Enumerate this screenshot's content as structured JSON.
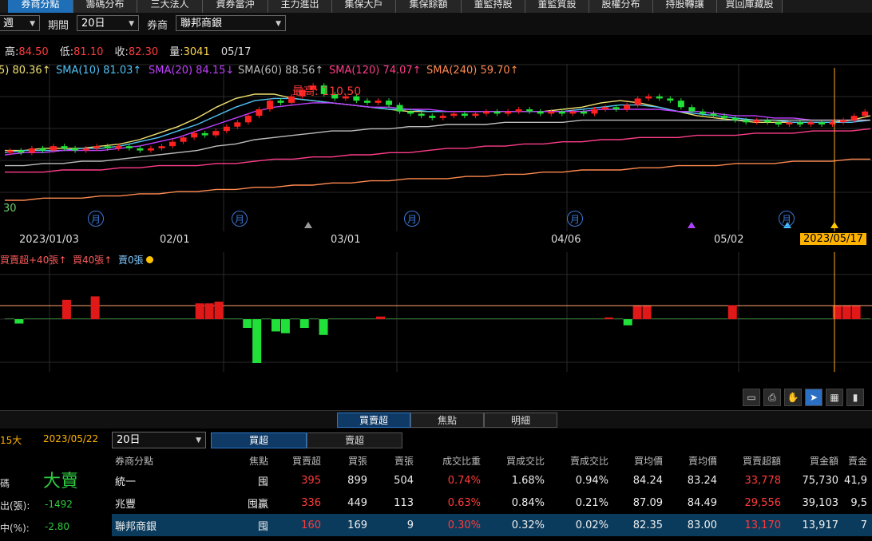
{
  "top_tabs": [
    {
      "label": "券商分點",
      "active": true
    },
    {
      "label": "籌碼分布"
    },
    {
      "label": "三大法人"
    },
    {
      "label": "資券當沖"
    },
    {
      "label": "主力進出"
    },
    {
      "label": "集保大戶"
    },
    {
      "label": "集保餘額"
    },
    {
      "label": "董監持股"
    },
    {
      "label": "董監質設"
    },
    {
      "label": "股權分布"
    },
    {
      "label": "持股轉讓"
    },
    {
      "label": "買回庫藏股"
    }
  ],
  "filter": {
    "first_select": "週",
    "period_label": "期間",
    "period_value": "20日",
    "broker_label": "券商",
    "broker_value": "聯邦商銀"
  },
  "quote": {
    "high_label": "高:",
    "high": "84.50",
    "low_label": "低:",
    "low": "81.10",
    "close_label": "收:",
    "close": "82.30",
    "vol_label": "量:",
    "volume": "3041",
    "date": "05/17"
  },
  "sma_legend": [
    {
      "text": "5) 80.36↑",
      "color": "#f0e070"
    },
    {
      "text": "SMA(10) 81.03↑",
      "color": "#4fc3f7"
    },
    {
      "text": "SMA(20) 84.15↓",
      "color": "#c040ff"
    },
    {
      "text": "SMA(60) 88.56↑",
      "color": "#bdbdbd"
    },
    {
      "text": "SMA(120) 74.07↑",
      "color": "#ff3d8a"
    },
    {
      "text": "SMA(240) 59.70↑",
      "color": "#ff8a50"
    }
  ],
  "max_label": "最高: 110.50",
  "left_price": "30",
  "x_labels": [
    "2023/01/03",
    "02/01",
    "03/01",
    "04/06",
    "05/02"
  ],
  "cursor_date": "2023/05/17",
  "month_marker": "月",
  "vol_legend": {
    "t1": "買賣超+40張↑",
    "t2": "買40張↑",
    "t3": "賣0張"
  },
  "tool_icons": [
    "page-icon",
    "print-icon",
    "hand-icon",
    "pointer-icon",
    "table-icon",
    "bar-chart-icon"
  ],
  "sub_tabs": [
    {
      "label": "買賣超",
      "active": true
    },
    {
      "label": "焦點"
    },
    {
      "label": "明細"
    }
  ],
  "left_panel": {
    "period": "15大",
    "date": "2023/05/22",
    "signal_label": "碼",
    "signal": "大賣",
    "net_label": "出(張):",
    "net": "-1492",
    "pct_label": "中(%):",
    "pct": "-2.80"
  },
  "range_select": "20日",
  "buysell_tabs": [
    "買超",
    "賣超"
  ],
  "table": {
    "headers": [
      "券商分點",
      "焦點",
      "買賣超",
      "買張",
      "賣張",
      "成交比重",
      "買成交比",
      "賣成交比",
      "買均價",
      "賣均價",
      "買賣超額",
      "買金額",
      "賣金"
    ],
    "rows": [
      [
        "統一",
        "囤",
        "395",
        "899",
        "504",
        "0.74%",
        "1.68%",
        "0.94%",
        "84.24",
        "83.24",
        "33,778",
        "75,730",
        "41,9"
      ],
      [
        "兆豐",
        "囤贏",
        "336",
        "449",
        "113",
        "0.63%",
        "0.84%",
        "0.21%",
        "87.09",
        "84.49",
        "29,556",
        "39,103",
        "9,5"
      ],
      [
        "聯邦商銀",
        "囤",
        "160",
        "169",
        "9",
        "0.30%",
        "0.32%",
        "0.02%",
        "82.35",
        "83.00",
        "13,170",
        "13,917",
        "7"
      ]
    ]
  },
  "chart_data": {
    "type": "candlestick",
    "price_range": [
      50,
      120
    ],
    "candles": [
      [
        79,
        80
      ],
      [
        80,
        79
      ],
      [
        79,
        81
      ],
      [
        81,
        80
      ],
      [
        80,
        82
      ],
      [
        82,
        81
      ],
      [
        81,
        80
      ],
      [
        80,
        81
      ],
      [
        81,
        82
      ],
      [
        82,
        81
      ],
      [
        81,
        82
      ],
      [
        82,
        81
      ],
      [
        81,
        80
      ],
      [
        80,
        81
      ],
      [
        81,
        82
      ],
      [
        82,
        84
      ],
      [
        84,
        86
      ],
      [
        86,
        88
      ],
      [
        88,
        87
      ],
      [
        87,
        89
      ],
      [
        89,
        91
      ],
      [
        91,
        93
      ],
      [
        93,
        96
      ],
      [
        96,
        99
      ],
      [
        99,
        103
      ],
      [
        103,
        102
      ],
      [
        102,
        105
      ],
      [
        105,
        108
      ],
      [
        108,
        110
      ],
      [
        110,
        106
      ],
      [
        106,
        104
      ],
      [
        104,
        105
      ],
      [
        105,
        103
      ],
      [
        103,
        102
      ],
      [
        102,
        103
      ],
      [
        103,
        101
      ],
      [
        101,
        98
      ],
      [
        98,
        97
      ],
      [
        97,
        96
      ],
      [
        96,
        95
      ],
      [
        95,
        96
      ],
      [
        96,
        97
      ],
      [
        97,
        96
      ],
      [
        96,
        97
      ],
      [
        97,
        98
      ],
      [
        98,
        97
      ],
      [
        97,
        98
      ],
      [
        98,
        99
      ],
      [
        99,
        98
      ],
      [
        98,
        97
      ],
      [
        97,
        98
      ],
      [
        98,
        97
      ],
      [
        97,
        98
      ],
      [
        98,
        97
      ],
      [
        97,
        99
      ],
      [
        99,
        100
      ],
      [
        100,
        99
      ],
      [
        99,
        101
      ],
      [
        101,
        104
      ],
      [
        104,
        105
      ],
      [
        105,
        104
      ],
      [
        104,
        103
      ],
      [
        103,
        100
      ],
      [
        100,
        98
      ],
      [
        98,
        97
      ],
      [
        97,
        96
      ],
      [
        96,
        95
      ],
      [
        95,
        94
      ],
      [
        94,
        93
      ],
      [
        93,
        94
      ],
      [
        94,
        93
      ],
      [
        93,
        92
      ],
      [
        92,
        93
      ],
      [
        93,
        92
      ],
      [
        92,
        93
      ],
      [
        93,
        92
      ],
      [
        92,
        93
      ],
      [
        93,
        94
      ],
      [
        94,
        96
      ],
      [
        96,
        98
      ]
    ],
    "sma": {
      "SMA5": [
        80,
        80,
        81,
        81,
        81,
        82,
        83,
        85,
        88,
        91,
        95,
        100,
        104,
        106,
        106,
        104,
        103,
        102,
        101,
        100,
        99,
        98,
        98,
        98,
        98,
        98,
        98,
        98,
        98,
        99,
        100,
        102,
        103,
        102,
        100,
        98,
        96,
        95,
        94,
        93,
        93,
        93,
        93,
        93,
        94,
        96
      ],
      "SMA10": [
        79,
        80,
        80,
        80,
        81,
        81,
        82,
        84,
        86,
        89,
        92,
        96,
        100,
        103,
        104,
        104,
        103,
        102,
        101,
        100,
        99,
        99,
        98,
        98,
        98,
        98,
        98,
        98,
        98,
        98,
        99,
        100,
        101,
        101,
        100,
        98,
        97,
        96,
        95,
        94,
        94,
        93,
        93,
        93,
        93,
        94
      ],
      "SMA20": [
        78,
        79,
        79,
        80,
        80,
        80,
        81,
        82,
        84,
        86,
        89,
        92,
        95,
        98,
        100,
        101,
        102,
        102,
        101,
        100,
        100,
        99,
        99,
        98,
        98,
        98,
        98,
        98,
        98,
        98,
        98,
        99,
        99,
        99,
        99,
        98,
        98,
        97,
        96,
        96,
        95,
        95,
        94,
        94,
        94,
        94
      ],
      "SMA60": [
        73,
        73,
        74,
        74,
        75,
        75,
        76,
        77,
        78,
        79,
        80,
        82,
        83,
        85,
        86,
        87,
        88,
        89,
        89,
        90,
        90,
        91,
        91,
        92,
        92,
        92,
        93,
        93,
        93,
        93,
        94,
        94,
        94,
        94,
        94,
        94,
        94,
        94,
        94,
        94,
        94,
        94,
        94,
        94,
        94,
        94
      ],
      "SMA120": [
        70,
        70,
        70,
        71,
        71,
        71,
        72,
        72,
        73,
        73,
        73,
        74,
        74,
        75,
        76,
        76,
        77,
        77,
        78,
        78,
        79,
        79,
        80,
        81,
        81,
        82,
        82,
        83,
        83,
        84,
        84,
        85,
        85,
        86,
        86,
        86,
        87,
        87,
        87,
        88,
        88,
        88,
        89,
        89,
        89,
        90
      ],
      "SMA240": [
        57,
        57,
        58,
        58,
        58,
        59,
        59,
        60,
        60,
        61,
        61,
        62,
        62,
        63,
        63,
        64,
        64,
        65,
        65,
        66,
        66,
        67,
        67,
        67,
        68,
        68,
        69,
        69,
        70,
        70,
        71,
        71,
        71,
        72,
        72,
        73,
        73,
        73,
        74,
        74,
        74,
        75,
        75,
        75,
        76,
        76
      ]
    },
    "volume": [
      0,
      -5,
      0,
      0,
      0,
      0,
      22,
      0,
      0,
      26,
      0,
      0,
      0,
      0,
      0,
      0,
      0,
      0,
      0,
      0,
      18,
      18,
      20,
      0,
      0,
      -10,
      -50,
      0,
      -14,
      -16,
      0,
      -10,
      0,
      -18,
      0,
      0,
      0,
      0,
      0,
      3,
      0,
      0,
      0,
      0,
      0,
      0,
      0,
      0,
      0,
      0,
      0,
      0,
      0,
      0,
      0,
      0,
      0,
      0,
      0,
      0,
      0,
      0,
      0,
      2,
      0,
      -7,
      15,
      15,
      0,
      0,
      0,
      0,
      0,
      0,
      0,
      0,
      16,
      0,
      0,
      0,
      0,
      0,
      0,
      0,
      0,
      0,
      0,
      15,
      15,
      15,
      0
    ],
    "volume_range": [
      -55,
      40
    ],
    "markers": [
      {
        "date": "02/14",
        "color": "#999999"
      },
      {
        "date": "04/24",
        "color": "#b040ff"
      },
      {
        "date": "05/11",
        "color": "#40c4ff"
      }
    ]
  }
}
